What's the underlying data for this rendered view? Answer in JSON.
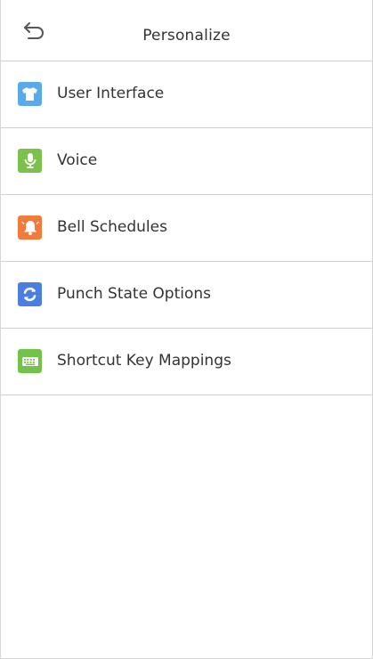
{
  "header": {
    "title": "Personalize",
    "back_icon": "back-arrow-icon"
  },
  "menu": {
    "items": [
      {
        "label": "User Interface",
        "icon": "shirt-icon",
        "color": "#5aa9ec"
      },
      {
        "label": "Voice",
        "icon": "microphone-icon",
        "color": "#7cc14c"
      },
      {
        "label": "Bell Schedules",
        "icon": "bell-icon",
        "color": "#f27a3c"
      },
      {
        "label": "Punch State Options",
        "icon": "refresh-icon",
        "color": "#4a7ee0"
      },
      {
        "label": "Shortcut Key Mappings",
        "icon": "keyboard-icon",
        "color": "#73c24a"
      }
    ]
  }
}
